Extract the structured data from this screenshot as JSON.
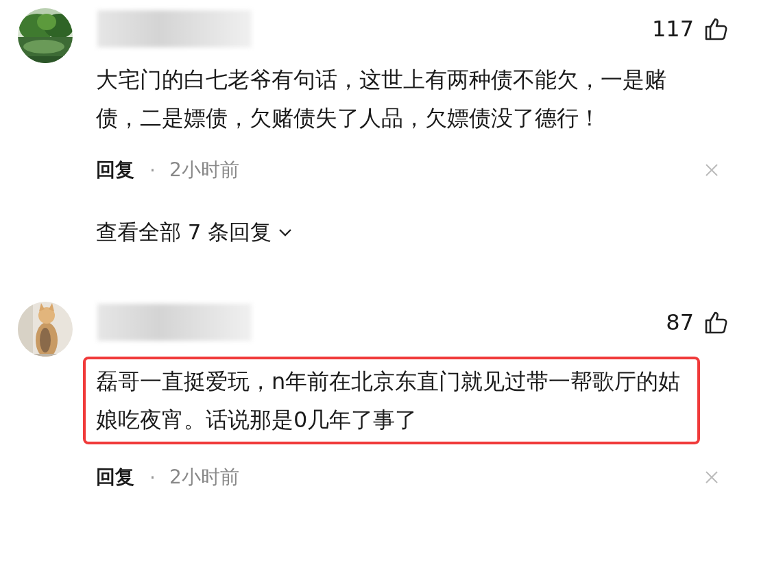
{
  "comments": [
    {
      "likes": "117",
      "text": "大宅门的白七老爷有句话，这世上有两种债不能欠，一是赌债，二是嫖债，欠赌债失了人品，欠嫖债没了德行！",
      "highlighted": false,
      "reply_label": "回复",
      "separator": "·",
      "time": "2小时前",
      "more_replies": "查看全部 7 条回复"
    },
    {
      "likes": "87",
      "text": "磊哥一直挺爱玩，n年前在北京东直门就见过带一帮歌厅的姑娘吃夜宵。话说那是0几年了事了",
      "highlighted": true,
      "reply_label": "回复",
      "separator": "·",
      "time": "2小时前"
    }
  ]
}
